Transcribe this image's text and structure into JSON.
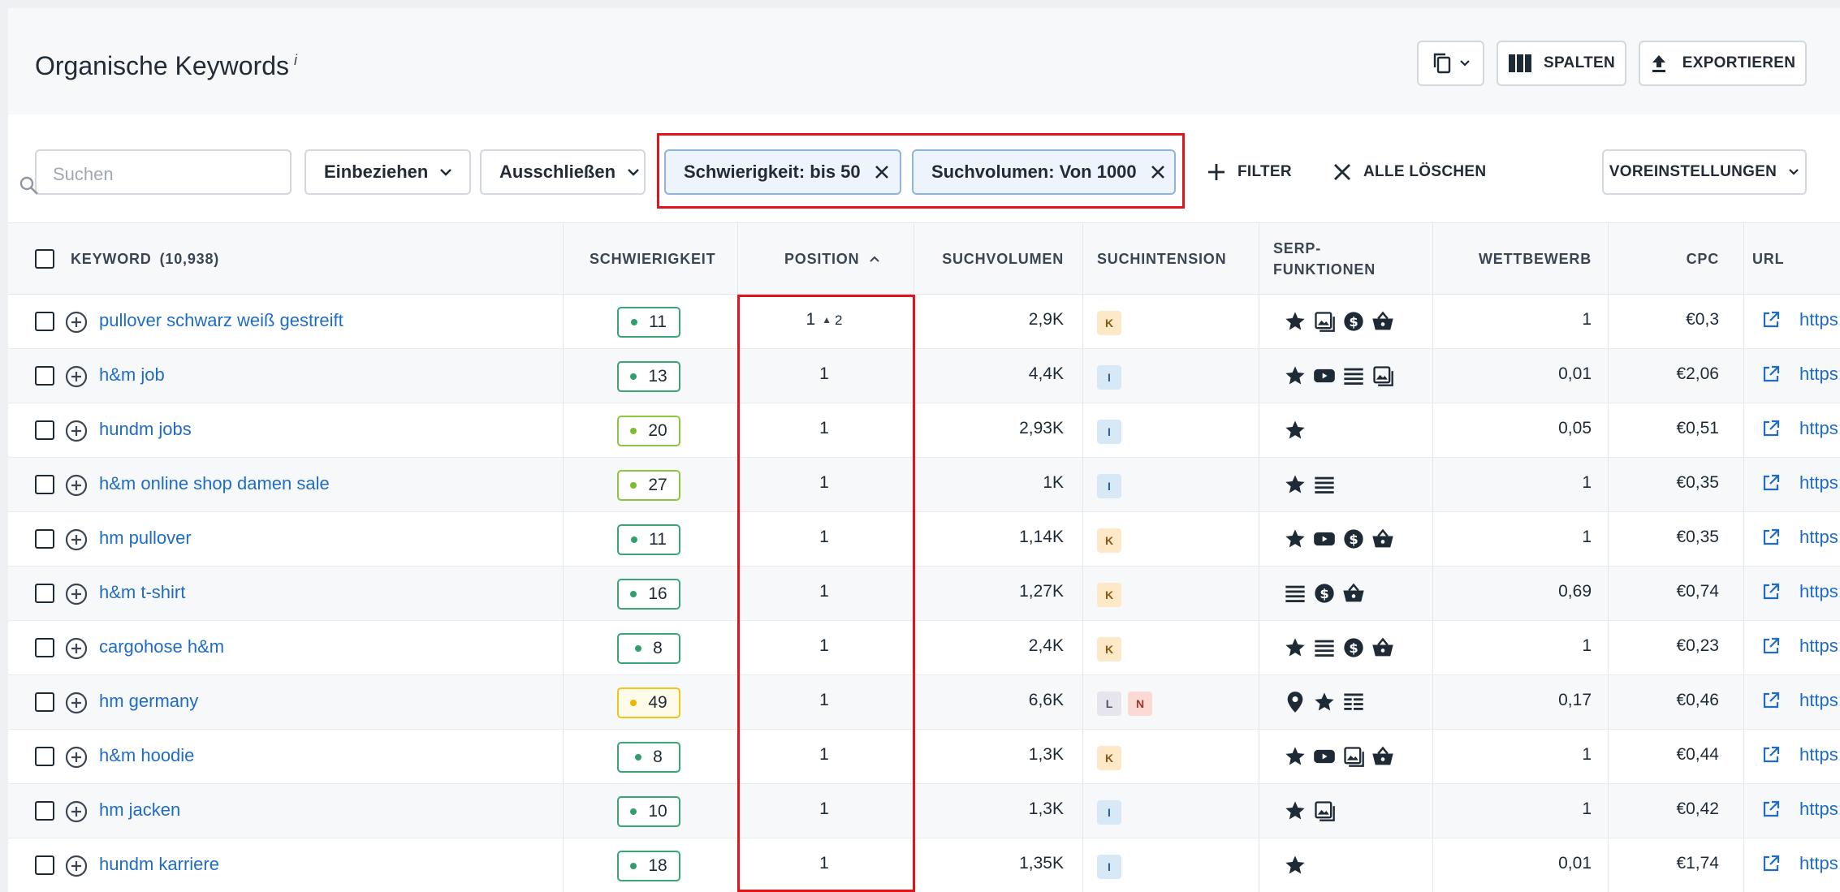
{
  "header": {
    "title": "Organische Keywords",
    "info": "i",
    "columns_button": "SPALTEN",
    "export_button": "EXPORTIEREN"
  },
  "toolbar": {
    "search_placeholder": "Suchen",
    "include_label": "Einbeziehen",
    "exclude_label": "Ausschließen",
    "chips": [
      "Schwierigkeit: bis 50",
      "Suchvolumen: Von 1000"
    ],
    "add_filter": "FILTER",
    "clear_all": "ALLE LÖSCHEN",
    "presets": "VOREINSTELLUNGEN"
  },
  "table": {
    "columns": {
      "keyword": "KEYWORD",
      "keyword_count": "(10,938)",
      "difficulty": "SCHWIERIGKEIT",
      "position": "POSITION",
      "volume": "SUCHVOLUMEN",
      "intent": "SUCHINTENSION",
      "serp_line1": "SERP-",
      "serp_line2": "FUNKTIONEN",
      "competition": "WETTBEWERB",
      "cpc": "CPC",
      "url": "URL"
    },
    "rows": [
      {
        "keyword": "pullover schwarz weiß gestreift",
        "difficulty": "11",
        "diff_color": "green",
        "position": "1",
        "position_prev": "2",
        "volume": "2,9K",
        "intent": [
          "K"
        ],
        "serp": [
          "star",
          "image",
          "dollar",
          "basket"
        ],
        "competition": "1",
        "cpc": "€0,3",
        "url": "https:/"
      },
      {
        "keyword": "h&m job",
        "difficulty": "13",
        "diff_color": "green",
        "position": "1",
        "position_prev": "",
        "volume": "4,4K",
        "intent": [
          "I"
        ],
        "serp": [
          "star",
          "video",
          "list",
          "image"
        ],
        "competition": "0,01",
        "cpc": "€2,06",
        "url": "https:/"
      },
      {
        "keyword": "hundm jobs",
        "difficulty": "20",
        "diff_color": "lime",
        "position": "1",
        "position_prev": "",
        "volume": "2,93K",
        "intent": [
          "I"
        ],
        "serp": [
          "star"
        ],
        "competition": "0,05",
        "cpc": "€0,51",
        "url": "https:/"
      },
      {
        "keyword": "h&m online shop damen sale",
        "difficulty": "27",
        "diff_color": "lime",
        "position": "1",
        "position_prev": "",
        "volume": "1K",
        "intent": [
          "I"
        ],
        "serp": [
          "star",
          "list"
        ],
        "competition": "1",
        "cpc": "€0,35",
        "url": "https:/"
      },
      {
        "keyword": "hm pullover",
        "difficulty": "11",
        "diff_color": "green",
        "position": "1",
        "position_prev": "",
        "volume": "1,14K",
        "intent": [
          "K"
        ],
        "serp": [
          "star",
          "video",
          "dollar",
          "basket"
        ],
        "competition": "1",
        "cpc": "€0,35",
        "url": "https:/"
      },
      {
        "keyword": "h&m t-shirt",
        "difficulty": "16",
        "diff_color": "green",
        "position": "1",
        "position_prev": "",
        "volume": "1,27K",
        "intent": [
          "K"
        ],
        "serp": [
          "list",
          "dollar",
          "basket"
        ],
        "competition": "0,69",
        "cpc": "€0,74",
        "url": "https:/"
      },
      {
        "keyword": "cargohose h&m",
        "difficulty": "8",
        "diff_color": "green",
        "position": "1",
        "position_prev": "",
        "volume": "2,4K",
        "intent": [
          "K"
        ],
        "serp": [
          "star",
          "list",
          "dollar",
          "basket"
        ],
        "competition": "1",
        "cpc": "€0,23",
        "url": "https:/"
      },
      {
        "keyword": "hm germany",
        "difficulty": "49",
        "diff_color": "yellow",
        "position": "1",
        "position_prev": "",
        "volume": "6,6K",
        "intent": [
          "L",
          "N"
        ],
        "serp": [
          "pin",
          "star",
          "table"
        ],
        "competition": "0,17",
        "cpc": "€0,46",
        "url": "https:/"
      },
      {
        "keyword": "h&m hoodie",
        "difficulty": "8",
        "diff_color": "green",
        "position": "1",
        "position_prev": "",
        "volume": "1,3K",
        "intent": [
          "K"
        ],
        "serp": [
          "star",
          "video",
          "image",
          "basket"
        ],
        "competition": "1",
        "cpc": "€0,44",
        "url": "https:/"
      },
      {
        "keyword": "hm jacken",
        "difficulty": "10",
        "diff_color": "green",
        "position": "1",
        "position_prev": "",
        "volume": "1,3K",
        "intent": [
          "I"
        ],
        "serp": [
          "star",
          "image"
        ],
        "competition": "1",
        "cpc": "€0,42",
        "url": "https:/"
      },
      {
        "keyword": "hundm karriere",
        "difficulty": "18",
        "diff_color": "green",
        "position": "1",
        "position_prev": "",
        "volume": "1,35K",
        "intent": [
          "I"
        ],
        "serp": [
          "star"
        ],
        "competition": "0,01",
        "cpc": "€1,74",
        "url": "https:/"
      }
    ]
  },
  "colors": {
    "link": "#1e6cc8",
    "highlight": "#e0151b",
    "chip_border": "#8fb4dc",
    "difficulty_green": "#3aa576",
    "difficulty_lime": "#8cc63f",
    "difficulty_yellow": "#f0c419"
  }
}
